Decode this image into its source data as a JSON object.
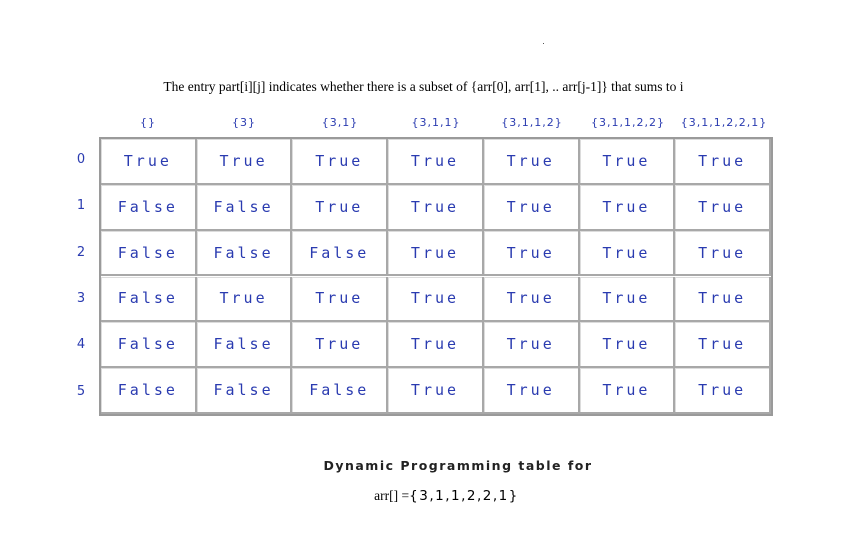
{
  "caption_top": "The entry part[i][j] indicates whether there is a subset of {arr[0], arr[1], .. arr[j-1]} that sums to i",
  "column_headers": [
    "{}",
    "{3}",
    "{3,1}",
    "{3,1,1}",
    "{3,1,1,2}",
    "{3,1,1,2,2}",
    "{3,1,1,2,2,1}"
  ],
  "row_labels": [
    "0",
    "1",
    "2",
    "3",
    "4",
    "5"
  ],
  "table": [
    [
      "True",
      "True",
      "True",
      "True",
      "True",
      "True",
      "True"
    ],
    [
      "False",
      "False",
      "True",
      "True",
      "True",
      "True",
      "True"
    ],
    [
      "False",
      "False",
      "False",
      "True",
      "True",
      "True",
      "True"
    ],
    [
      "False",
      "True",
      "True",
      "True",
      "True",
      "True",
      "True"
    ],
    [
      "False",
      "False",
      "True",
      "True",
      "True",
      "True",
      "True"
    ],
    [
      "False",
      "False",
      "False",
      "True",
      "True",
      "True",
      "True"
    ]
  ],
  "caption_bottom": {
    "line1": "Dynamic Programming table for",
    "line2_prefix": "arr[] =",
    "line2_value": "{3,1,1,2,2,1}"
  },
  "colors": {
    "cell_text": "#2a3bb0",
    "grid_border": "#9a9a9a"
  }
}
